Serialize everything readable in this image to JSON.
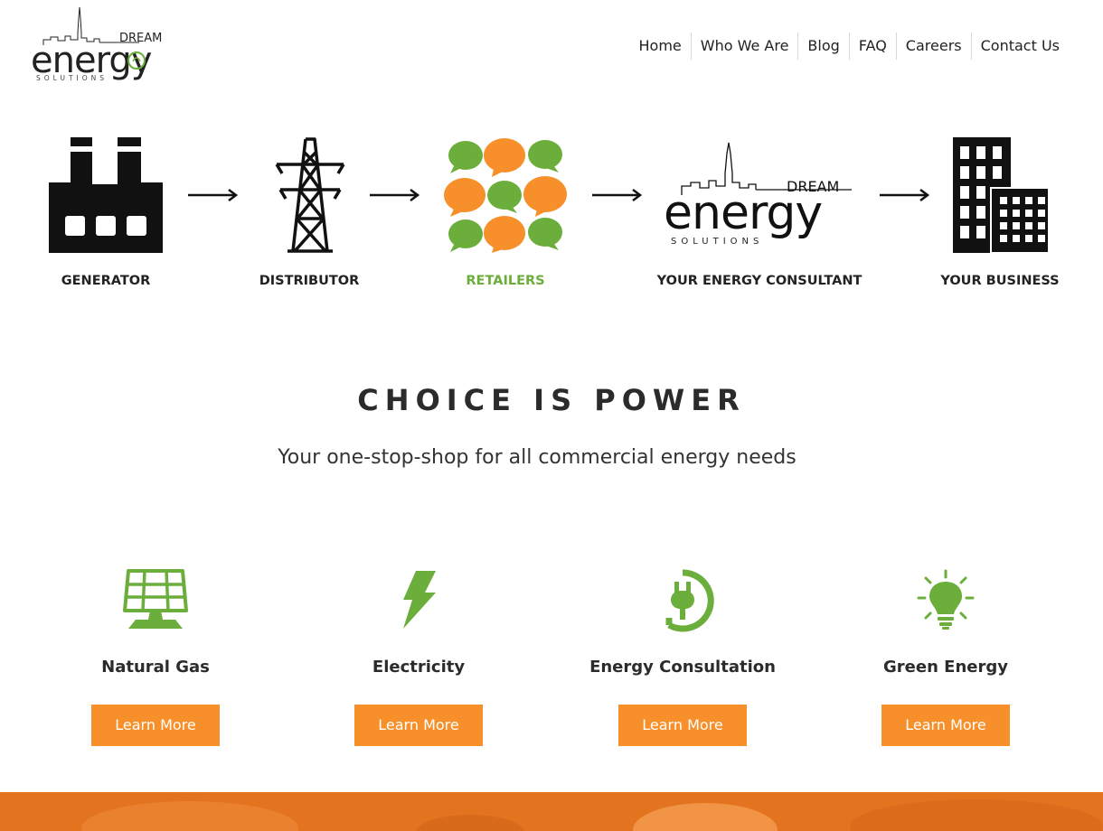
{
  "logo": {
    "brand_word": "energy",
    "brand_top": "DREAM",
    "brand_sub": "SOLUTIONS"
  },
  "nav": {
    "items": [
      "Home",
      "Who We Are",
      "Blog",
      "FAQ",
      "Careers",
      "Contact Us"
    ]
  },
  "flow": {
    "steps": [
      "GENERATOR",
      "DISTRIBUTOR",
      "RETAILERS",
      "YOUR ENERGY CONSULTANT",
      "YOUR BUSINESS"
    ],
    "highlight_color": "#6cae3b"
  },
  "headline": {
    "title": "CHOICE IS POWER",
    "subtitle": "Your one-stop-shop for all commercial energy needs"
  },
  "services": [
    {
      "title": "Natural Gas",
      "button": "Learn More",
      "icon": "solar-panel-icon"
    },
    {
      "title": "Electricity",
      "button": "Learn More",
      "icon": "lightning-bolt-icon"
    },
    {
      "title": "Energy Consultation",
      "button": "Learn More",
      "icon": "power-plug-icon"
    },
    {
      "title": "Green Energy",
      "button": "Learn More",
      "icon": "lightbulb-icon"
    }
  ],
  "colors": {
    "accent_orange": "#f7902a",
    "accent_green": "#6cae3b",
    "text_dark": "#222222"
  }
}
